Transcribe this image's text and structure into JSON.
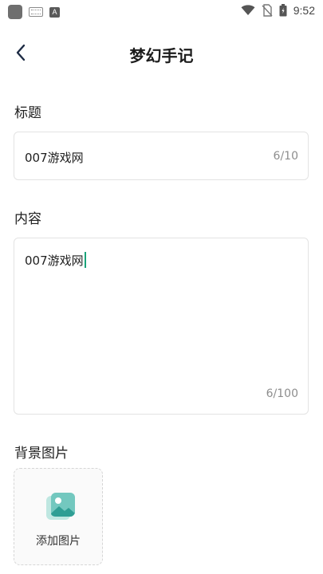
{
  "status_bar": {
    "time": "9:52",
    "icons": [
      "notification-square-icon",
      "keyboard-icon",
      "a-badge-icon",
      "wifi-icon",
      "no-sim-icon",
      "battery-icon"
    ]
  },
  "header": {
    "title": "梦幻手记",
    "back_icon": "chevron-left-icon"
  },
  "form": {
    "title_section": {
      "label": "标题",
      "value": "007游戏网",
      "counter": "6/10"
    },
    "content_section": {
      "label": "内容",
      "value": "007游戏网",
      "counter": "6/100"
    },
    "background_section": {
      "label": "背景图片",
      "add_label": "添加图片",
      "icon": "image-icon"
    }
  },
  "colors": {
    "cursor": "#1aa37a",
    "icon_teal": "#47b6ad",
    "icon_light": "#bfe7e1"
  }
}
